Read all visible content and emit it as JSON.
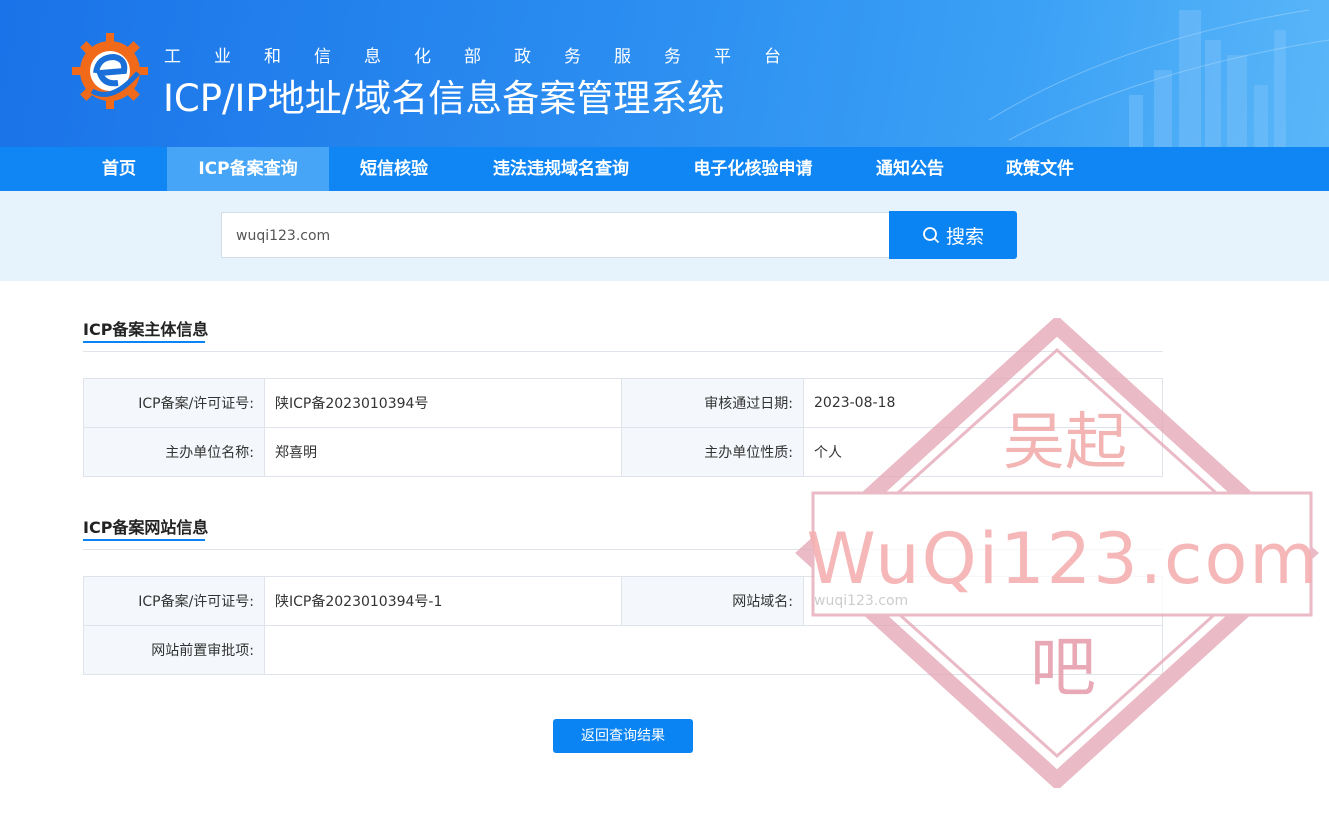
{
  "header": {
    "subtitle_chars": [
      "工",
      "业",
      "和",
      "信",
      "息",
      "化",
      "部",
      "政",
      "务",
      "服",
      "务",
      "平",
      "台"
    ],
    "title": "ICP/IP地址/域名信息备案管理系统"
  },
  "nav": {
    "items": [
      {
        "label": "首页"
      },
      {
        "label": "ICP备案查询",
        "active": true
      },
      {
        "label": "短信核验"
      },
      {
        "label": "违法违规域名查询"
      },
      {
        "label": "电子化核验申请"
      },
      {
        "label": "通知公告"
      },
      {
        "label": "政策文件"
      }
    ]
  },
  "search": {
    "value": "wuqi123.com",
    "button_label": "搜索",
    "button_icon": "search-icon"
  },
  "subject_info": {
    "title": "ICP备案主体信息",
    "rows": [
      {
        "label1": "ICP备案/许可证号:",
        "value1": "陕ICP备2023010394号",
        "label2": "审核通过日期:",
        "value2": "2023-08-18"
      },
      {
        "label1": "主办单位名称:",
        "value1": "郑喜明",
        "label2": "主办单位性质:",
        "value2": "个人"
      }
    ]
  },
  "site_info": {
    "title": "ICP备案网站信息",
    "rows": [
      {
        "label1": "ICP备案/许可证号:",
        "value1": "陕ICP备2023010394号-1",
        "label2": "网站域名:",
        "value2": "wuqi123.com"
      },
      {
        "label1": "网站前置审批项:",
        "value1": ""
      }
    ]
  },
  "back_button": "返回查询结果",
  "watermark": {
    "top_text": "吴起",
    "middle_text": "WuQi123.com",
    "bottom_text": "吧",
    "color": "#e8a0b0"
  },
  "colors": {
    "nav_bg": "#0f86f4",
    "nav_active": "#46a5f7",
    "accent": "#0b84f3"
  }
}
